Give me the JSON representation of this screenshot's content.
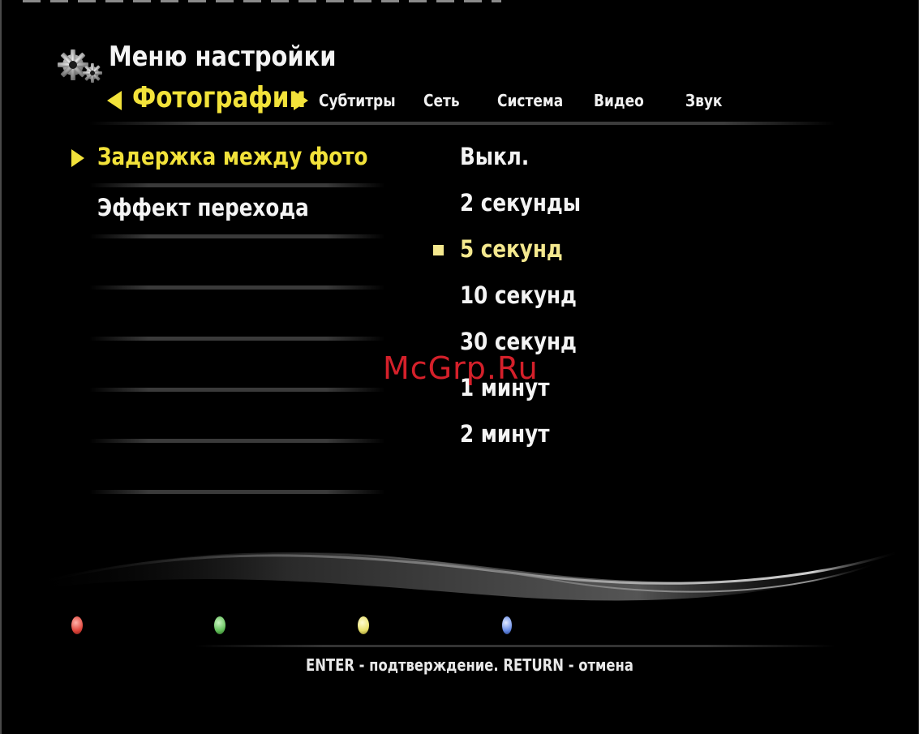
{
  "header": {
    "title": "Меню настройки",
    "icon": "gears-icon"
  },
  "tabs": {
    "active": "Фотографии",
    "items": [
      "Субтитры",
      "Сеть",
      "Система",
      "Видео",
      "Звук"
    ]
  },
  "menu": {
    "items": [
      {
        "label": "Задержка между фото",
        "selected": true
      },
      {
        "label": "Эффект перехода",
        "selected": false
      }
    ]
  },
  "options": {
    "items": [
      "Выкл.",
      "2 секунды",
      "5 секунд",
      "10 секунд",
      "30 секунд",
      "1 минут",
      "2 минут"
    ],
    "current": "5 секунд"
  },
  "watermark": "McGrp.Ru",
  "color_buttons": [
    {
      "name": "red",
      "color": "#e0463c"
    },
    {
      "name": "green",
      "color": "#63c05a"
    },
    {
      "name": "yellow",
      "color": "#e8e06a"
    },
    {
      "name": "blue",
      "color": "#6a8ee8"
    }
  ],
  "footer": {
    "hint": "ENTER - подтверждение. RETURN - отмена"
  },
  "colors": {
    "accent": "#f2e23a",
    "background": "#000000"
  }
}
